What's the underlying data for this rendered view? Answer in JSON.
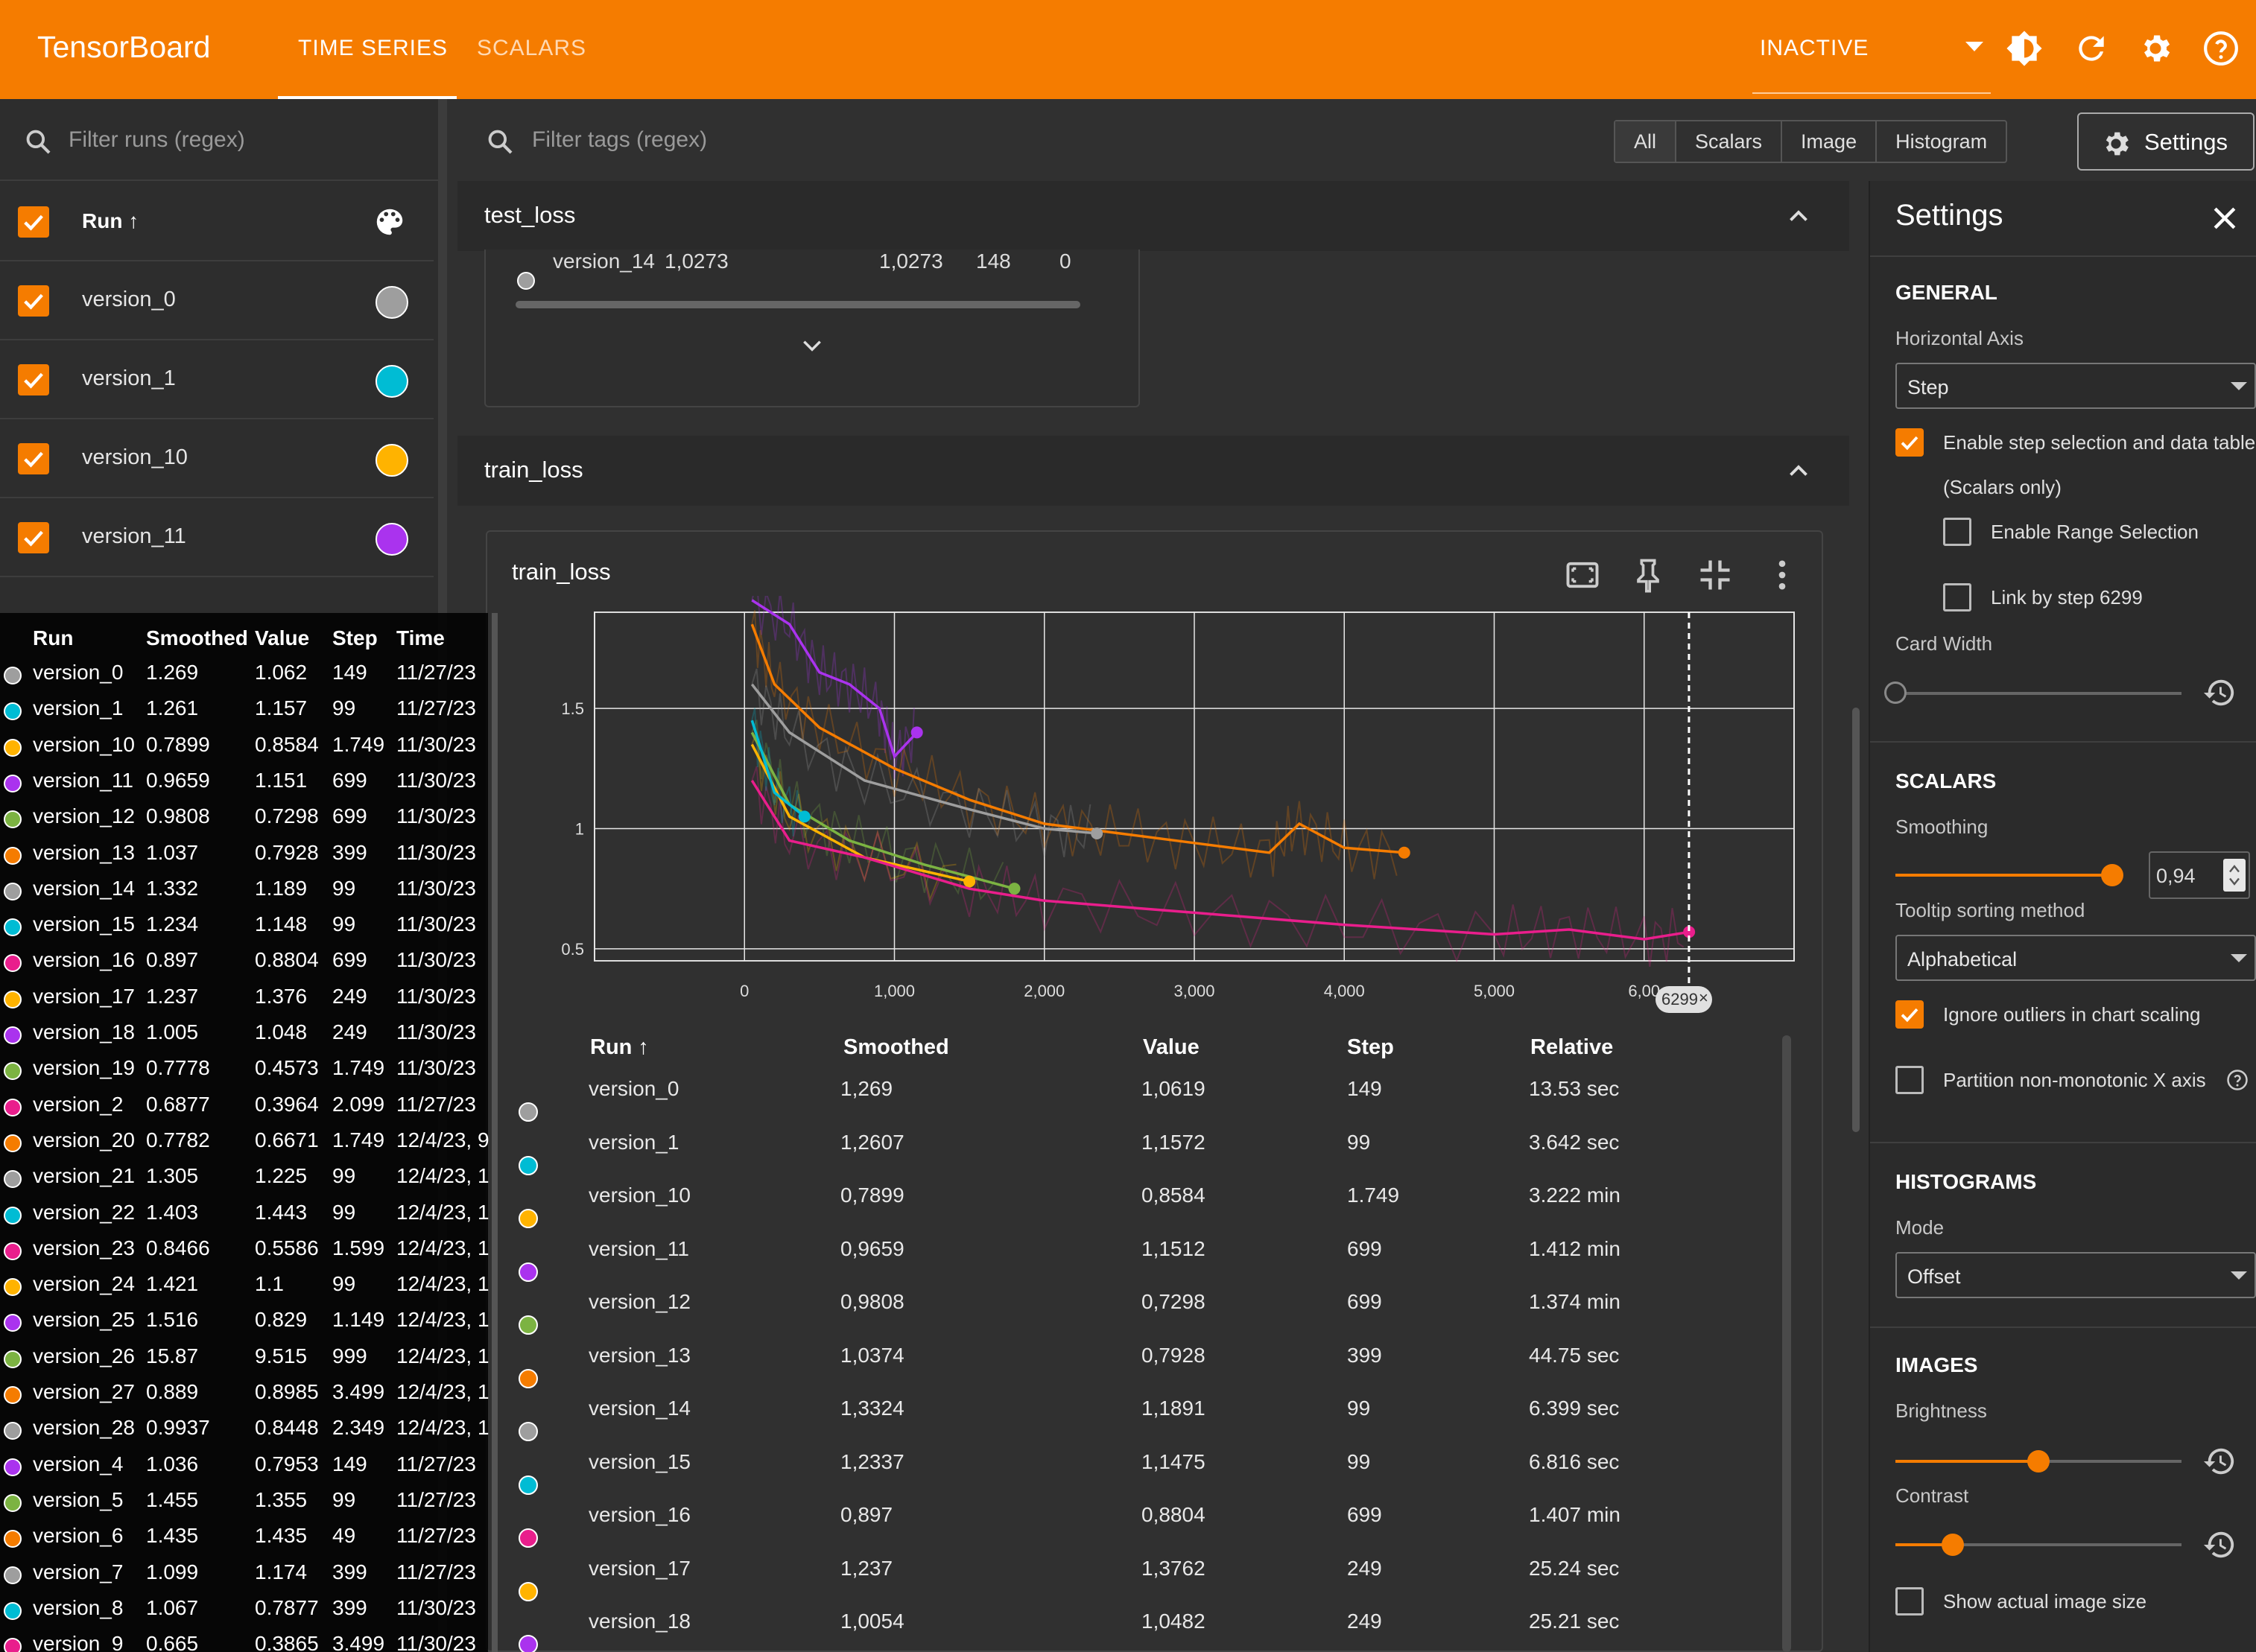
{
  "app": {
    "title": "TensorBoard",
    "tabs": [
      "TIME SERIES",
      "SCALARS"
    ],
    "status": "INACTIVE"
  },
  "runs_filter": {
    "placeholder": "Filter runs (regex)"
  },
  "tags_filter": {
    "placeholder": "Filter tags (regex)"
  },
  "type_chips": [
    "All",
    "Scalars",
    "Image",
    "Histogram"
  ],
  "settings_button": "Settings",
  "runs_header": "Run ↑",
  "visible_runs": [
    {
      "name": "version_0",
      "color": "#9e9e9e"
    },
    {
      "name": "version_1",
      "color": "#00bcd4"
    },
    {
      "name": "version_10",
      "color": "#ffb300"
    },
    {
      "name": "version_11",
      "color": "#aa33ee"
    }
  ],
  "tooltip": {
    "headers": [
      "Run",
      "Smoothed",
      "Value",
      "Step",
      "Time"
    ],
    "rows": [
      {
        "run": "version_0",
        "smoothed": "1.269",
        "value": "1.062",
        "step": "149",
        "time": "11/27/23",
        "color": "#9e9e9e"
      },
      {
        "run": "version_1",
        "smoothed": "1.261",
        "value": "1.157",
        "step": "99",
        "time": "11/27/23",
        "color": "#00bcd4"
      },
      {
        "run": "version_10",
        "smoothed": "0.7899",
        "value": "0.8584",
        "step": "1.749",
        "time": "11/30/23",
        "color": "#ffb300"
      },
      {
        "run": "version_11",
        "smoothed": "0.9659",
        "value": "1.151",
        "step": "699",
        "time": "11/30/23",
        "color": "#aa33ee"
      },
      {
        "run": "version_12",
        "smoothed": "0.9808",
        "value": "0.7298",
        "step": "699",
        "time": "11/30/23",
        "color": "#7cb342"
      },
      {
        "run": "version_13",
        "smoothed": "1.037",
        "value": "0.7928",
        "step": "399",
        "time": "11/30/23",
        "color": "#f57c00"
      },
      {
        "run": "version_14",
        "smoothed": "1.332",
        "value": "1.189",
        "step": "99",
        "time": "11/30/23",
        "color": "#9e9e9e"
      },
      {
        "run": "version_15",
        "smoothed": "1.234",
        "value": "1.148",
        "step": "99",
        "time": "11/30/23",
        "color": "#00bcd4"
      },
      {
        "run": "version_16",
        "smoothed": "0.897",
        "value": "0.8804",
        "step": "699",
        "time": "11/30/23",
        "color": "#e91e8c"
      },
      {
        "run": "version_17",
        "smoothed": "1.237",
        "value": "1.376",
        "step": "249",
        "time": "11/30/23",
        "color": "#ffb300"
      },
      {
        "run": "version_18",
        "smoothed": "1.005",
        "value": "1.048",
        "step": "249",
        "time": "11/30/23",
        "color": "#aa33ee"
      },
      {
        "run": "version_19",
        "smoothed": "0.7778",
        "value": "0.4573",
        "step": "1.749",
        "time": "11/30/23",
        "color": "#7cb342"
      },
      {
        "run": "version_2",
        "smoothed": "0.6877",
        "value": "0.3964",
        "step": "2.099",
        "time": "11/27/23",
        "color": "#e91e8c"
      },
      {
        "run": "version_20",
        "smoothed": "0.7782",
        "value": "0.6671",
        "step": "1.749",
        "time": "12/4/23, 9",
        "color": "#f57c00"
      },
      {
        "run": "version_21",
        "smoothed": "1.305",
        "value": "1.225",
        "step": "99",
        "time": "12/4/23, 1",
        "color": "#9e9e9e"
      },
      {
        "run": "version_22",
        "smoothed": "1.403",
        "value": "1.443",
        "step": "99",
        "time": "12/4/23, 1",
        "color": "#00bcd4"
      },
      {
        "run": "version_23",
        "smoothed": "0.8466",
        "value": "0.5586",
        "step": "1.599",
        "time": "12/4/23, 1",
        "color": "#e91e8c"
      },
      {
        "run": "version_24",
        "smoothed": "1.421",
        "value": "1.1",
        "step": "99",
        "time": "12/4/23, 1",
        "color": "#ffb300"
      },
      {
        "run": "version_25",
        "smoothed": "1.516",
        "value": "0.829",
        "step": "1.149",
        "time": "12/4/23, 1",
        "color": "#aa33ee"
      },
      {
        "run": "version_26",
        "smoothed": "15.87",
        "value": "9.515",
        "step": "999",
        "time": "12/4/23, 1",
        "color": "#7cb342"
      },
      {
        "run": "version_27",
        "smoothed": "0.889",
        "value": "0.8985",
        "step": "3.499",
        "time": "12/4/23, 1",
        "color": "#f57c00"
      },
      {
        "run": "version_28",
        "smoothed": "0.9937",
        "value": "0.8448",
        "step": "2.349",
        "time": "12/4/23, 1",
        "color": "#9e9e9e"
      },
      {
        "run": "version_4",
        "smoothed": "1.036",
        "value": "0.7953",
        "step": "149",
        "time": "11/27/23",
        "color": "#aa33ee"
      },
      {
        "run": "version_5",
        "smoothed": "1.455",
        "value": "1.355",
        "step": "99",
        "time": "11/27/23",
        "color": "#7cb342"
      },
      {
        "run": "version_6",
        "smoothed": "1.435",
        "value": "1.435",
        "step": "49",
        "time": "11/27/23",
        "color": "#f57c00"
      },
      {
        "run": "version_7",
        "smoothed": "1.099",
        "value": "1.174",
        "step": "399",
        "time": "11/27/23",
        "color": "#9e9e9e"
      },
      {
        "run": "version_8",
        "smoothed": "1.067",
        "value": "0.7877",
        "step": "399",
        "time": "11/30/23",
        "color": "#00bcd4"
      },
      {
        "run": "version_9",
        "smoothed": "0.665",
        "value": "0.3865",
        "step": "3.499",
        "time": "11/30/23",
        "color": "#e91e8c"
      }
    ]
  },
  "test_loss": {
    "title": "test_loss",
    "row": {
      "run": "version_14",
      "smoothed": "1,0273",
      "value": "1,0273",
      "step": "148",
      "relative": "0"
    }
  },
  "train_loss": {
    "section_title": "train_loss",
    "card_title": "train_loss",
    "step_marker_label": "6299",
    "table_headers": [
      "Run ↑",
      "Smoothed",
      "Value",
      "Step",
      "Relative"
    ],
    "table_rows": [
      {
        "run": "version_0",
        "smoothed": "1,269",
        "value": "1,0619",
        "step": "149",
        "relative": "13.53 sec",
        "color": "#9e9e9e"
      },
      {
        "run": "version_1",
        "smoothed": "1,2607",
        "value": "1,1572",
        "step": "99",
        "relative": "3.642 sec",
        "color": "#00bcd4"
      },
      {
        "run": "version_10",
        "smoothed": "0,7899",
        "value": "0,8584",
        "step": "1.749",
        "relative": "3.222 min",
        "color": "#ffb300"
      },
      {
        "run": "version_11",
        "smoothed": "0,9659",
        "value": "1,1512",
        "step": "699",
        "relative": "1.412 min",
        "color": "#aa33ee"
      },
      {
        "run": "version_12",
        "smoothed": "0,9808",
        "value": "0,7298",
        "step": "699",
        "relative": "1.374 min",
        "color": "#7cb342"
      },
      {
        "run": "version_13",
        "smoothed": "1,0374",
        "value": "0,7928",
        "step": "399",
        "relative": "44.75 sec",
        "color": "#f57c00"
      },
      {
        "run": "version_14",
        "smoothed": "1,3324",
        "value": "1,1891",
        "step": "99",
        "relative": "6.399 sec",
        "color": "#9e9e9e"
      },
      {
        "run": "version_15",
        "smoothed": "1,2337",
        "value": "1,1475",
        "step": "99",
        "relative": "6.816 sec",
        "color": "#00bcd4"
      },
      {
        "run": "version_16",
        "smoothed": "0,897",
        "value": "0,8804",
        "step": "699",
        "relative": "1.407 min",
        "color": "#e91e8c"
      },
      {
        "run": "version_17",
        "smoothed": "1,237",
        "value": "1,3762",
        "step": "249",
        "relative": "25.24 sec",
        "color": "#ffb300"
      },
      {
        "run": "version_18",
        "smoothed": "1,0054",
        "value": "1,0482",
        "step": "249",
        "relative": "25.21 sec",
        "color": "#aa33ee"
      }
    ]
  },
  "chart_data": {
    "type": "line",
    "title": "train_loss",
    "xlim": [
      -1000,
      7000
    ],
    "ylim": [
      0.45,
      1.9
    ],
    "x_ticks": [
      "0",
      "1,000",
      "2,000",
      "3,000",
      "4,000",
      "5,000",
      "6,00"
    ],
    "y_ticks": [
      "0.5",
      "1",
      "1.5"
    ],
    "grid": true,
    "series": [
      {
        "name": "version_11",
        "color": "#aa33ee",
        "x": [
          50,
          300,
          500,
          700,
          900,
          1000,
          1150
        ],
        "y": [
          1.95,
          1.85,
          1.65,
          1.6,
          1.5,
          1.3,
          1.4
        ]
      },
      {
        "name": "version_13",
        "color": "#f57c00",
        "x": [
          50,
          200,
          500,
          1000,
          1500,
          2000,
          2500,
          3000,
          3500,
          3700,
          4000,
          4400
        ],
        "y": [
          1.85,
          1.6,
          1.42,
          1.25,
          1.12,
          1.02,
          0.98,
          0.94,
          0.9,
          1.02,
          0.92,
          0.9
        ]
      },
      {
        "name": "version_0",
        "color": "#9e9e9e",
        "x": [
          50,
          300,
          800,
          1500,
          2000,
          2350
        ],
        "y": [
          1.6,
          1.4,
          1.2,
          1.08,
          1.0,
          0.98
        ]
      },
      {
        "name": "version_12",
        "color": "#7cb342",
        "x": [
          50,
          300,
          700,
          1200,
          1800
        ],
        "y": [
          1.4,
          1.1,
          0.95,
          0.85,
          0.75
        ]
      },
      {
        "name": "version_10",
        "color": "#ffb300",
        "x": [
          50,
          300,
          800,
          1500
        ],
        "y": [
          1.35,
          1.05,
          0.88,
          0.78
        ]
      },
      {
        "name": "version_16",
        "color": "#e91e8c",
        "x": [
          50,
          300,
          800,
          1500,
          2000,
          3000,
          4000,
          5000,
          5500,
          6000,
          6300
        ],
        "y": [
          1.2,
          0.95,
          0.88,
          0.75,
          0.7,
          0.65,
          0.6,
          0.56,
          0.58,
          0.54,
          0.57
        ]
      },
      {
        "name": "version_1",
        "color": "#00bcd4",
        "x": [
          50,
          200,
          400
        ],
        "y": [
          1.45,
          1.15,
          1.05
        ]
      }
    ]
  },
  "settings": {
    "title": "Settings",
    "general": {
      "title": "GENERAL",
      "horizontal_axis_label": "Horizontal Axis",
      "horizontal_axis_value": "Step",
      "enable_step_selection": "Enable step selection and data table",
      "scalars_only": "(Scalars only)",
      "enable_range": "Enable Range Selection",
      "link_by_step": "Link by step 6299",
      "card_width_label": "Card Width",
      "card_width_level": 0
    },
    "scalars": {
      "title": "SCALARS",
      "smoothing_label": "Smoothing",
      "smoothing_value": "0,94",
      "tooltip_sort_label": "Tooltip sorting method",
      "tooltip_sort_value": "Alphabetical",
      "ignore_outliers": "Ignore outliers in chart scaling",
      "partition": "Partition non-monotonic X axis"
    },
    "histograms": {
      "title": "HISTOGRAMS",
      "mode_label": "Mode",
      "mode_value": "Offset"
    },
    "images": {
      "title": "IMAGES",
      "brightness_label": "Brightness",
      "brightness_level": 0.5,
      "contrast_label": "Contrast",
      "contrast_level": 0.2,
      "show_actual": "Show actual image size"
    }
  }
}
